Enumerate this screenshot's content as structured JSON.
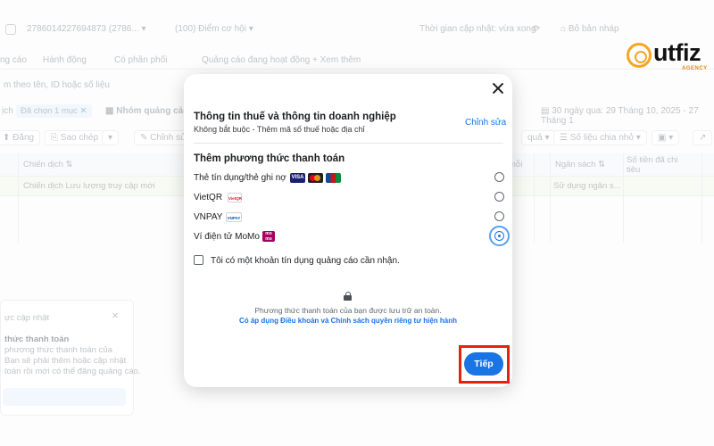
{
  "background": {
    "account_id": "2786014227694873 (2786...",
    "opportunity_score": "Điểm cơ hội",
    "update_time": "Thời gian cập nhật: vừa xong",
    "draft": "Bỏ bản nháp",
    "tabs": [
      "ng cáo",
      "Hành động",
      "Có phần phối",
      "Quảng cáo đang hoạt động",
      "+ Xem thêm"
    ],
    "search_placeholder": "m theo tên, ID hoặc số liệu",
    "selected_pill": "Đã chọn 1 mục",
    "campaign_group": "Nhóm quảng cáo",
    "date_range": "30 ngày qua: 29 Tháng 10, 2025 - 27 Tháng 1",
    "toolbar_buttons": [
      "Đăng",
      "Sao chép",
      "Chỉnh sửa",
      "quả",
      "Số liệu chia nhỏ"
    ],
    "table_headers": [
      "Chiến dịch",
      "mỗi",
      "Ngân sách",
      "Số tiền đã chi tiêu"
    ],
    "row": {
      "campaign": "Chiến dịch Lưu lượng truy cập mới",
      "budget": "Sử dụng ngân s..."
    },
    "toast": {
      "title": "ực cập nhật",
      "heading": "thức thanh toán",
      "line1": "phương thức thanh toán của",
      "line2": "Bạn sẽ phải thêm hoặc cập nhật",
      "line3": "toán rồi mới có thể đăng quảng cáo."
    }
  },
  "logo": {
    "text": "utfiz",
    "sub": "AGENCY",
    "accent": "#f5a623"
  },
  "modal": {
    "tax_title": "Thông tin thuế và thông tin doanh nghiệp",
    "tax_sub": "Không bắt buộc - Thêm mã số thuế hoặc địa chỉ",
    "edit": "Chỉnh sửa",
    "payment_title": "Thêm phương thức thanh toán",
    "methods": [
      {
        "label": "Thẻ tín dụng/thẻ ghi nợ",
        "icons": [
          "VISA",
          "Mastercard",
          "JCB"
        ],
        "selected": false
      },
      {
        "label": "VietQR",
        "icons": [
          "VietQR"
        ],
        "selected": false
      },
      {
        "label": "VNPAY",
        "icons": [
          "VNPAY"
        ],
        "selected": false
      },
      {
        "label": "Ví điện tử MoMo",
        "icons": [
          "MoMo"
        ],
        "selected": true
      }
    ],
    "card_badges": {
      "visa": "VISA",
      "vietqr": "VietQR",
      "vnpay": "VNPAY",
      "momo": "mo mo"
    },
    "credit_line_label": "Tôi có một khoản tín dụng quảng cáo cần nhận.",
    "secure_text": "Phương thức thanh toán của bạn được lưu trữ an toàn.",
    "terms_text": "Có áp dụng Điều khoản và Chính sách quyền riêng tư hiện hành",
    "next_button": "Tiếp"
  },
  "colors": {
    "primary": "#1b74e4",
    "highlight": "#e6220d"
  }
}
